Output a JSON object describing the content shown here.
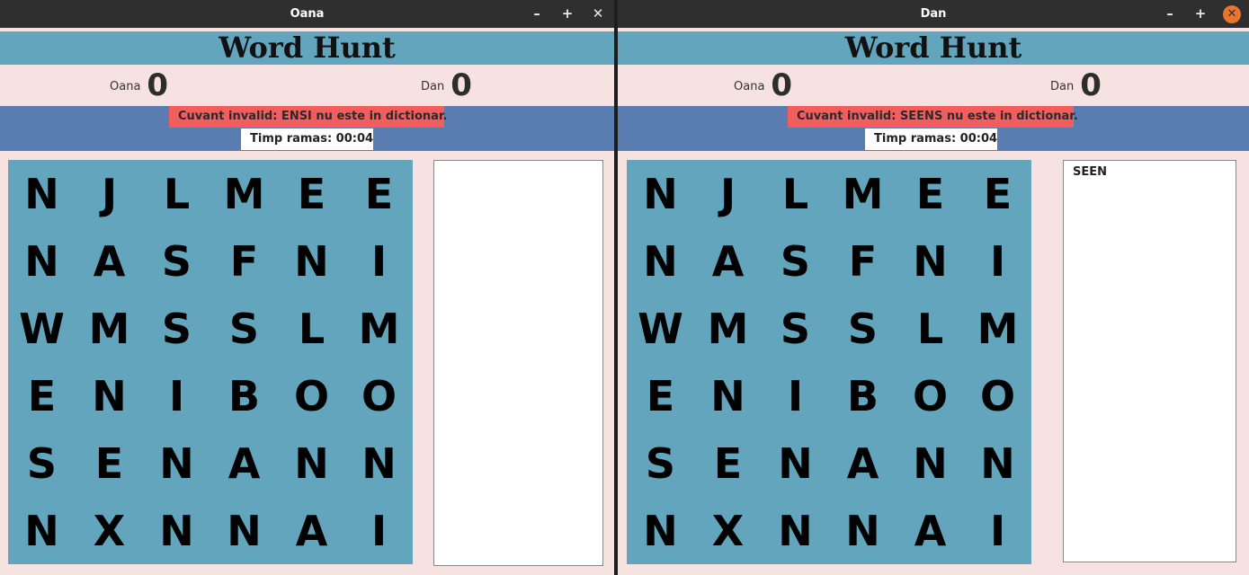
{
  "windows": {
    "left": {
      "title": "Oana",
      "controls": {
        "minimize": "–",
        "maximize": "+",
        "close": "✕"
      },
      "header_title": "Word Hunt",
      "players": [
        {
          "name": "Oana",
          "score": "0"
        },
        {
          "name": "Dan",
          "score": "0"
        }
      ],
      "message": "Cuvant invalid: ENSI nu este in dictionar.",
      "timer": "Timp ramas: 00:04",
      "board": [
        [
          "N",
          "J",
          "L",
          "M",
          "E",
          "E"
        ],
        [
          "N",
          "A",
          "S",
          "F",
          "N",
          "I"
        ],
        [
          "W",
          "M",
          "S",
          "S",
          "L",
          "M"
        ],
        [
          "E",
          "N",
          "I",
          "B",
          "O",
          "O"
        ],
        [
          "S",
          "E",
          "N",
          "A",
          "N",
          "N"
        ],
        [
          "N",
          "X",
          "N",
          "N",
          "A",
          "I"
        ]
      ],
      "words": []
    },
    "right": {
      "title": "Dan",
      "controls": {
        "minimize": "–",
        "maximize": "+",
        "close": "✕"
      },
      "header_title": "Word Hunt",
      "players": [
        {
          "name": "Oana",
          "score": "0"
        },
        {
          "name": "Dan",
          "score": "0"
        }
      ],
      "message": "Cuvant invalid: SEENS nu este in dictionar.",
      "timer": "Timp ramas: 00:04",
      "board": [
        [
          "N",
          "J",
          "L",
          "M",
          "E",
          "E"
        ],
        [
          "N",
          "A",
          "S",
          "F",
          "N",
          "I"
        ],
        [
          "W",
          "M",
          "S",
          "S",
          "L",
          "M"
        ],
        [
          "E",
          "N",
          "I",
          "B",
          "O",
          "O"
        ],
        [
          "S",
          "E",
          "N",
          "A",
          "N",
          "N"
        ],
        [
          "N",
          "X",
          "N",
          "N",
          "A",
          "I"
        ]
      ],
      "words": [
        "SEEN"
      ]
    }
  },
  "colors": {
    "header": "#62a5bd",
    "status_bar": "#5a7db1",
    "error_message": "#f25e5e",
    "background": "#f6e2e0",
    "close_button_active": "#e9742f"
  }
}
